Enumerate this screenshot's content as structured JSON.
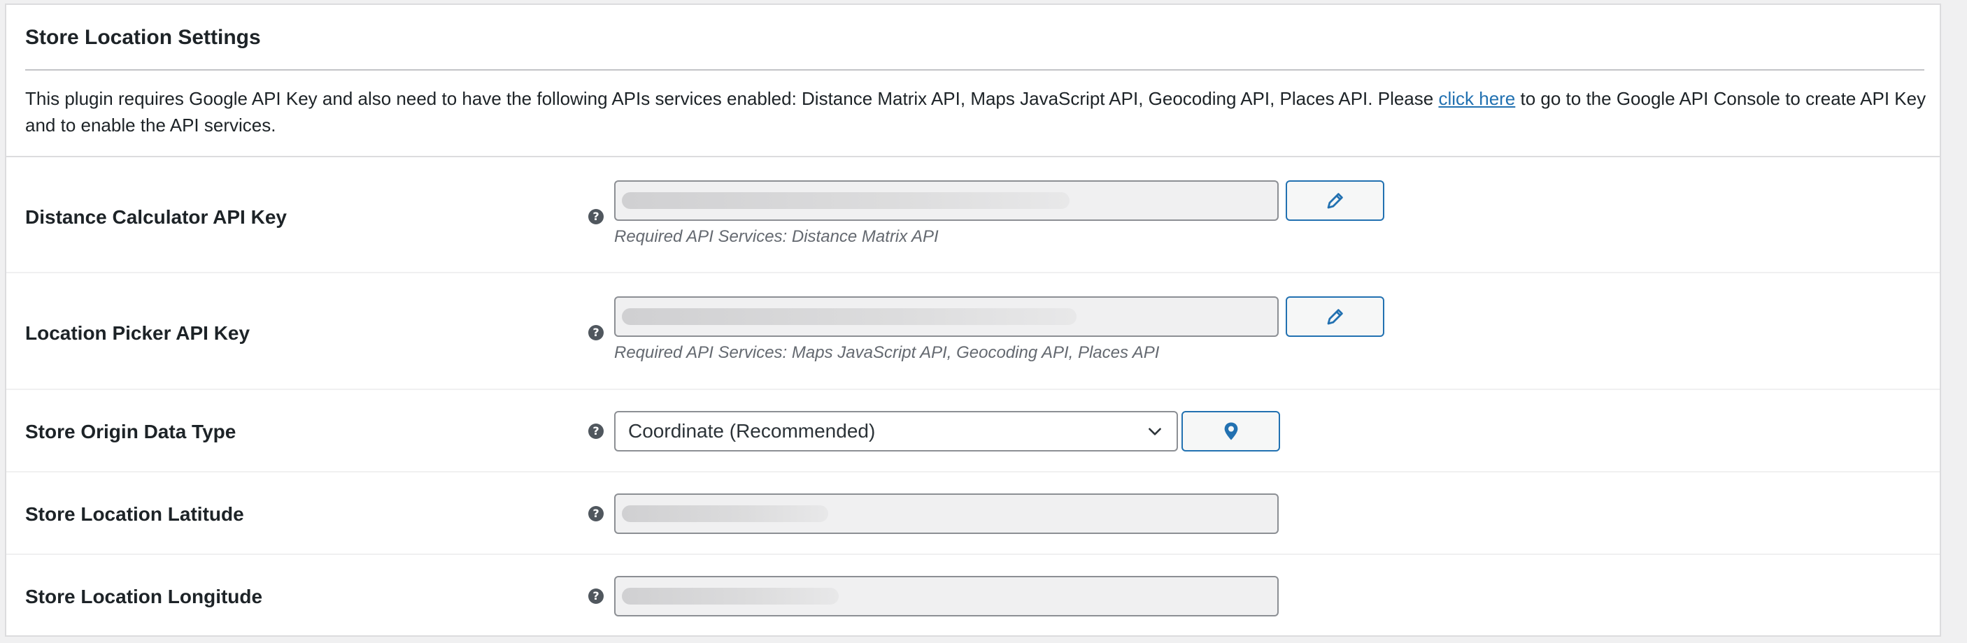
{
  "section": {
    "title": "Store Location Settings",
    "intro_before": "This plugin requires Google API Key and also need to have the following APIs services enabled: Distance Matrix API, Maps JavaScript API, Geocoding API, Places API. Please ",
    "intro_link": "click here",
    "intro_after": " to go to the Google API Console to create API Key and to enable the API services."
  },
  "rows": {
    "distance_key": {
      "label": "Distance Calculator API Key",
      "description": "Required API Services: Distance Matrix API",
      "value": ""
    },
    "picker_key": {
      "label": "Location Picker API Key",
      "description": "Required API Services: Maps JavaScript API, Geocoding API, Places API",
      "value": ""
    },
    "origin_type": {
      "label": "Store Origin Data Type",
      "selected": "Coordinate (Recommended)"
    },
    "latitude": {
      "label": "Store Location Latitude",
      "value": ""
    },
    "longitude": {
      "label": "Store Location Longitude",
      "value": ""
    }
  },
  "icons": {
    "help": "?",
    "edit": "pencil-icon",
    "map": "map-pin-icon",
    "dropdown": "chevron-down-icon"
  },
  "colors": {
    "accent": "#2271b1",
    "help_bg": "#50575e",
    "field_bg": "#f0f0f1",
    "border": "#8c8f94"
  }
}
